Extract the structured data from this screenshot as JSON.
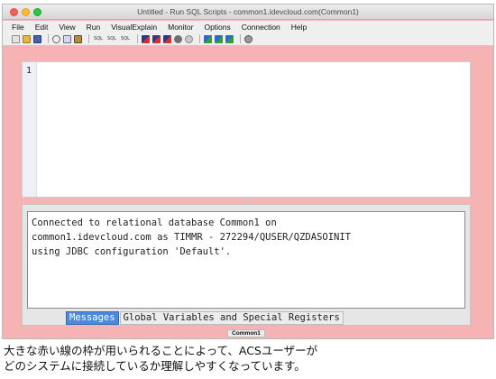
{
  "window": {
    "title": "Untitled - Run SQL Scripts - common1.idevcloud.com(Common1)",
    "frame_color": "#f5b3b3"
  },
  "menubar": {
    "items": [
      {
        "label": "File"
      },
      {
        "label": "Edit"
      },
      {
        "label": "View"
      },
      {
        "label": "Run"
      },
      {
        "label": "VisualExplain"
      },
      {
        "label": "Monitor"
      },
      {
        "label": "Options"
      },
      {
        "label": "Connection"
      },
      {
        "label": "Help"
      }
    ]
  },
  "toolbar": {
    "icons": [
      "new-file-icon",
      "open-folder-icon",
      "save-icon",
      "cut-icon",
      "copy-icon",
      "paste-icon",
      "sql-format-icon",
      "sql-syntax-icon",
      "sql-check-icon",
      "run-all-icon",
      "run-from-selected-icon",
      "run-selected-icon",
      "run-dot-icon",
      "stop-icon",
      "explain-icon",
      "run-and-explain-icon",
      "visual-explain-icon",
      "settings-gear-icon"
    ],
    "sql_text": "SQL"
  },
  "editor": {
    "line_number": "1",
    "content": ""
  },
  "messages": {
    "lines": [
      "Connected to relational database Common1 on",
      "common1.idevcloud.com as TIMMR - 272294/QUSER/QZDASOINIT",
      "using JDBC configuration 'Default'."
    ]
  },
  "tabs": [
    {
      "label": "Messages",
      "active": true
    },
    {
      "label": "Global Variables and Special Registers",
      "active": false
    }
  ],
  "statusbar": {
    "connection": "Common1"
  },
  "caption": {
    "line1": "大きな赤い線の枠が用いられることによって、ACSユーザーが",
    "line2": "どのシステムに接続しているか理解しやすくなっています。"
  }
}
